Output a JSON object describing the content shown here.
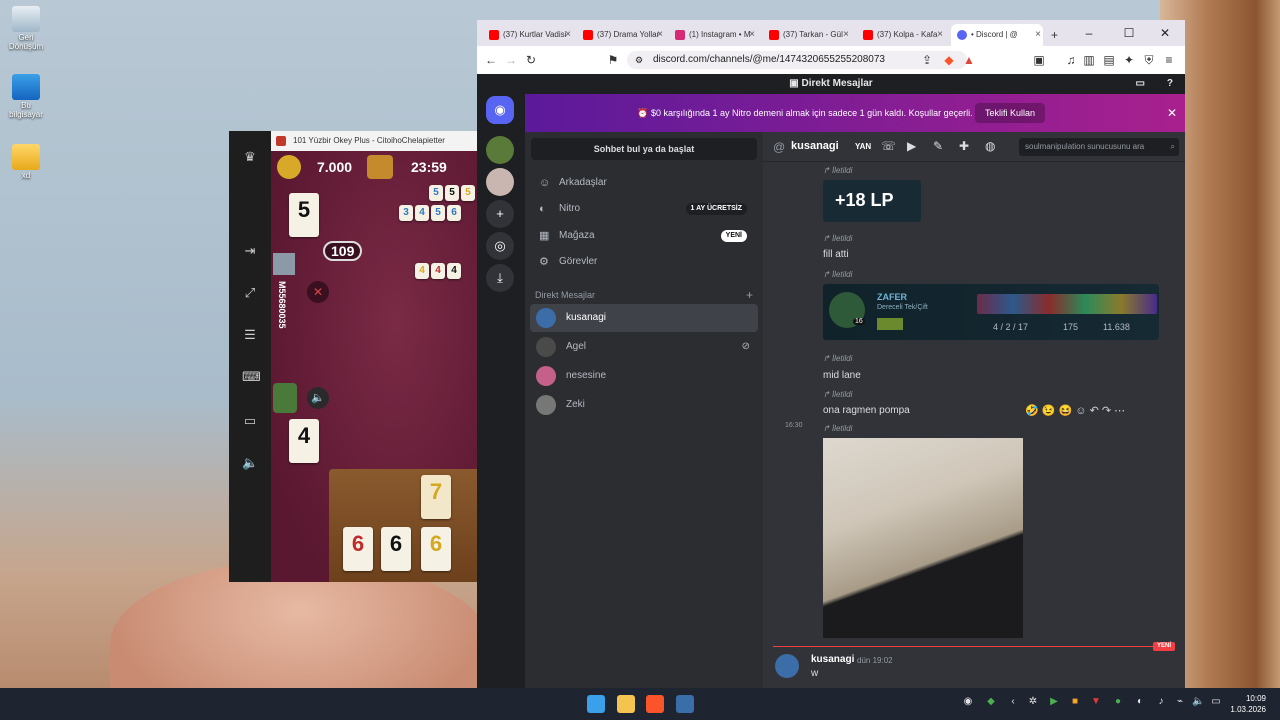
{
  "desktop": {
    "icons": [
      {
        "label": "Geri Dönüşüm",
        "icon": "recycle-bin-icon"
      },
      {
        "label": "Bu bilgisayar",
        "icon": "monitor-icon"
      },
      {
        "label": "xd",
        "icon": "folder-icon"
      }
    ]
  },
  "game": {
    "window_title": "101 Yüzbir Okey Plus - CitoihoChelapietter",
    "coins": "7.000",
    "timer": "23:59",
    "player_tile_top": "5",
    "player_tile_bottom": "4",
    "points_badge": "109",
    "player_id": "M55680035",
    "table_tiles_row1": [
      "5",
      "5",
      "5"
    ],
    "table_tiles_row2": [
      "3",
      "4",
      "5",
      "6"
    ],
    "table_tiles_row3": [
      "4",
      "4",
      "4"
    ],
    "rack_top": [
      "7"
    ],
    "rack_bottom": [
      "6",
      "6",
      "6"
    ]
  },
  "browser": {
    "tabs": [
      {
        "label": "(37) Kurtlar Vadisi",
        "icon": "youtube-icon",
        "color": "#ff0000"
      },
      {
        "label": "(37) Drama Yollar",
        "icon": "youtube-icon",
        "color": "#ff0000"
      },
      {
        "label": "(1) Instagram • M",
        "icon": "instagram-icon",
        "color": "#d62976"
      },
      {
        "label": "(37) Tarkan - Gül",
        "icon": "youtube-icon",
        "color": "#ff0000"
      },
      {
        "label": "(37) Kolpa - Kafa",
        "icon": "youtube-icon",
        "color": "#ff0000"
      },
      {
        "label": "• Discord | @",
        "icon": "discord-icon",
        "color": "#5865f2"
      }
    ],
    "new_tab": "+",
    "url": "discord.com/channels/@me/1474320655255208073"
  },
  "discord": {
    "top_title": "Direkt Mesajlar",
    "nitro_banner": "$0 karşılığında 1 ay Nitro demeni almak için sadece 1 gün kaldı. Koşullar geçerli.",
    "nitro_button": "Teklifi Kullan",
    "search_dm": "Sohbet bul ya da başlat",
    "nav": [
      {
        "label": "Arkadaşlar",
        "icon": "friends-icon"
      },
      {
        "label": "Nitro",
        "icon": "nitro-icon",
        "badge": "1 AY ÜCRETSİZ"
      },
      {
        "label": "Mağaza",
        "icon": "shop-icon",
        "badge": "YENİ"
      },
      {
        "label": "Görevler",
        "icon": "quests-icon"
      }
    ],
    "dm_header": "Direkt Mesajlar",
    "dm_add": "+",
    "dms": [
      {
        "name": "kusanagi",
        "selected": true,
        "color": "#3b6ea8"
      },
      {
        "name": "Agel",
        "selected": false,
        "color": "#4a4a4a"
      },
      {
        "name": "nesesine",
        "selected": false,
        "color": "#c4608a"
      },
      {
        "name": "Zeki",
        "selected": false,
        "color": "#777777"
      }
    ],
    "chat": {
      "header_name": "kusanagi",
      "header_tag": "YAN",
      "search_placeholder": "soulmanipulation sunucusunu ara",
      "forwarded_label": "İletildi",
      "lp_text": "+18 LP",
      "msg_fill": "fill atti",
      "match": {
        "name": "ZAFER",
        "queue": "Dereceli Tek/Çift",
        "level": "16",
        "kda": "4 / 2 / 17",
        "cs": "175",
        "gold": "11.638"
      },
      "msg_mid": "mid lane",
      "msg_pompa": "ona ragmen pompa",
      "time_1630": "16:30",
      "new_label": "YENİ",
      "last_author": "kusanagi",
      "last_time": "dün 19:02",
      "last_text": "w"
    }
  },
  "taskbar": {
    "time": "10:09",
    "date": "1.03.2026"
  }
}
